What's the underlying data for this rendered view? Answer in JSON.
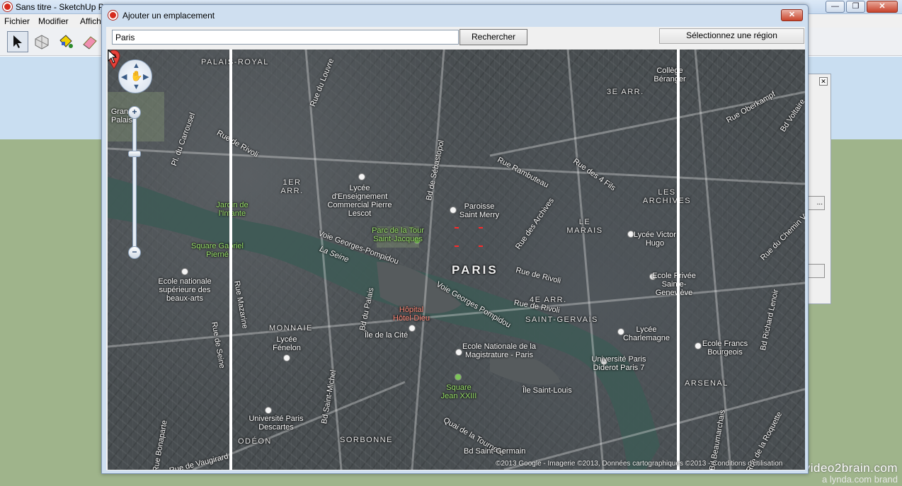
{
  "app": {
    "title": "Sans titre - SketchUp P",
    "menu": [
      "Fichier",
      "Modifier",
      "Affich"
    ],
    "toolbar_tools": [
      "select-tool",
      "component-tool",
      "paint-bucket-tool",
      "eraser-tool"
    ]
  },
  "dialog": {
    "title": "Ajouter un emplacement",
    "search_value": "Paris",
    "search_button": "Rechercher",
    "region_button": "Sélectionnez une région",
    "close_symbol": "✕"
  },
  "map": {
    "districts": [
      "PALAIS-ROYAL",
      "3E ARR.",
      "1ER ARR.",
      "LES ARCHIVES",
      "LE MARAIS",
      "PARIS",
      "4E ARR.",
      "SAINT-GERVAIS",
      "MONNAIE",
      "SORBONNE",
      "ODÉON",
      "ARSENAL"
    ],
    "streets": [
      "Rue du Louvre",
      "Pl. du Carrousel",
      "Rue de Rivoli",
      "Bd de Sébastopol",
      "Rue Rambuteau",
      "Rue des 4 Fils",
      "Rue des Archives",
      "Voie Georges-Pompidou",
      "La Seine",
      "Rue de Rivoli",
      "Voie Georges Pompidou",
      "Rue de Seine",
      "Rue Mazarine",
      "Bd du Palais",
      "Île de la Cité",
      "Bd Saint-Michel",
      "Quai de la Tournelle",
      "Bd Saint-Germain",
      "Rue Bonaparte",
      "Rue de Vaugirard",
      "Île Saint-Louis",
      "Rue Oberkampf",
      "Bd Voltaire",
      "Rue du Chemin Vert",
      "Bd Richard Lenoir",
      "Bd Beaumarchais",
      "Rue de la Roquette",
      "Rue de Rivoli"
    ],
    "places": [
      "Lycée d'Enseignement Commercial Pierre Lescot",
      "Paroisse Saint Merry",
      "Parc de la Tour Saint-Jacques",
      "Jardin de l'Infante",
      "Square Gabriel Pierné",
      "Ecole nationale supérieure des beaux-arts",
      "Hôpital Hôtel-Dieu",
      "Lycée Fénelon",
      "Ecole Nationale de la Magistrature - Paris",
      "Square Jean XXIII",
      "Université Paris Descartes",
      "Lycée Charlemagne",
      "Université Paris Diderot Paris 7",
      "Lycée Victor Hugo",
      "Ecole Privée Sainte-Geneviève",
      "Ecole Francs Bourgeois",
      "Collège Béranger",
      "Grand Palais"
    ],
    "copyright": "©2013 Google - Imagerie ©2013, Données cartographiques ©2013 - Conditions d'utilisation"
  },
  "panel": {
    "close_symbol": "✕",
    "button_label": "..."
  },
  "watermark": {
    "main": "video2brain.com",
    "sub": "a lynda.com brand"
  },
  "colors": {
    "accent_red": "#d52b1e",
    "selection_line": "#ffffff",
    "park_label": "#9be36b"
  }
}
